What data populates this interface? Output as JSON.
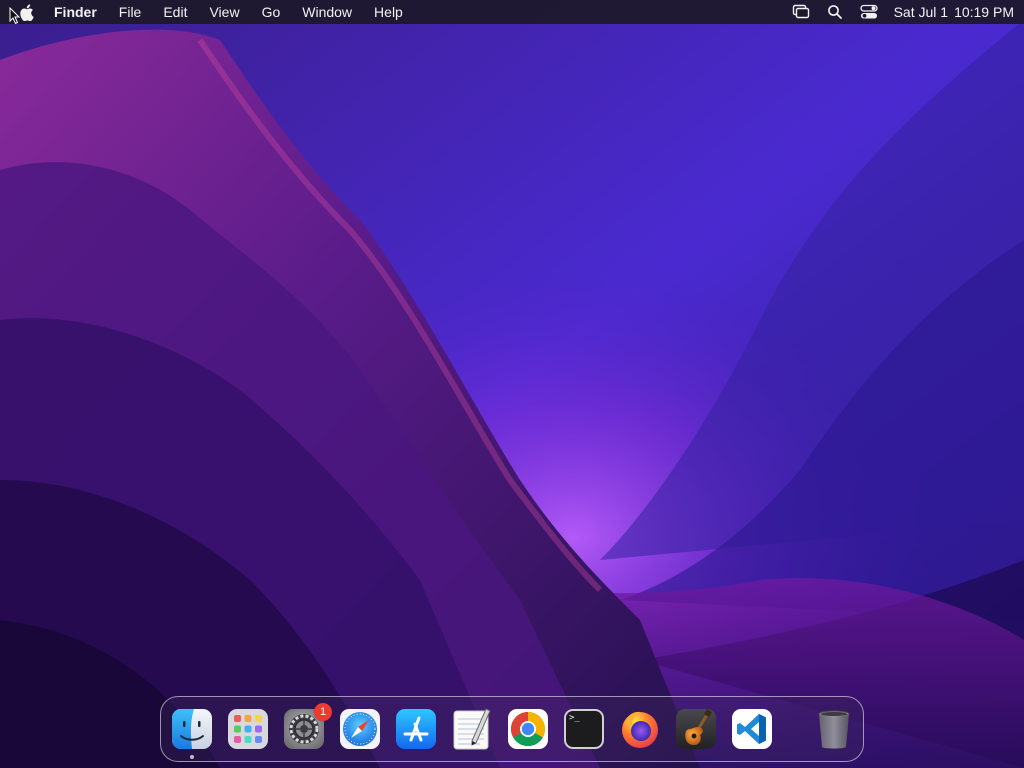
{
  "menubar": {
    "icon": "apple-logo-icon",
    "app_name": "Finder",
    "menus": [
      "File",
      "Edit",
      "View",
      "Go",
      "Window",
      "Help"
    ],
    "status_icons": [
      "screen-mirroring-icon",
      "spotlight-search-icon",
      "control-center-icon"
    ],
    "date": "Sat Jul 1",
    "time": "10:19 PM"
  },
  "dock": {
    "apps": [
      {
        "id": "finder",
        "icon": "finder-icon",
        "running": true
      },
      {
        "id": "launchpad",
        "icon": "launchpad-icon"
      },
      {
        "id": "system-settings",
        "icon": "system-settings-gear-icon",
        "badge": "1"
      },
      {
        "id": "safari",
        "icon": "safari-compass-icon"
      },
      {
        "id": "app-store",
        "icon": "app-store-icon"
      },
      {
        "id": "textedit",
        "icon": "textedit-icon"
      },
      {
        "id": "chrome",
        "icon": "chrome-icon"
      },
      {
        "id": "terminal",
        "icon": "terminal-icon",
        "prompt": ">_"
      },
      {
        "id": "firefox",
        "icon": "firefox-icon"
      },
      {
        "id": "garageband",
        "icon": "garageband-guitar-icon"
      },
      {
        "id": "vscode",
        "icon": "vscode-icon"
      }
    ],
    "trash": {
      "icon": "trash-icon"
    }
  },
  "colors": {
    "menubar_bg": "#1c1828",
    "badge": "#ee3b30",
    "wallpaper_accent": "#8a1fb0"
  }
}
